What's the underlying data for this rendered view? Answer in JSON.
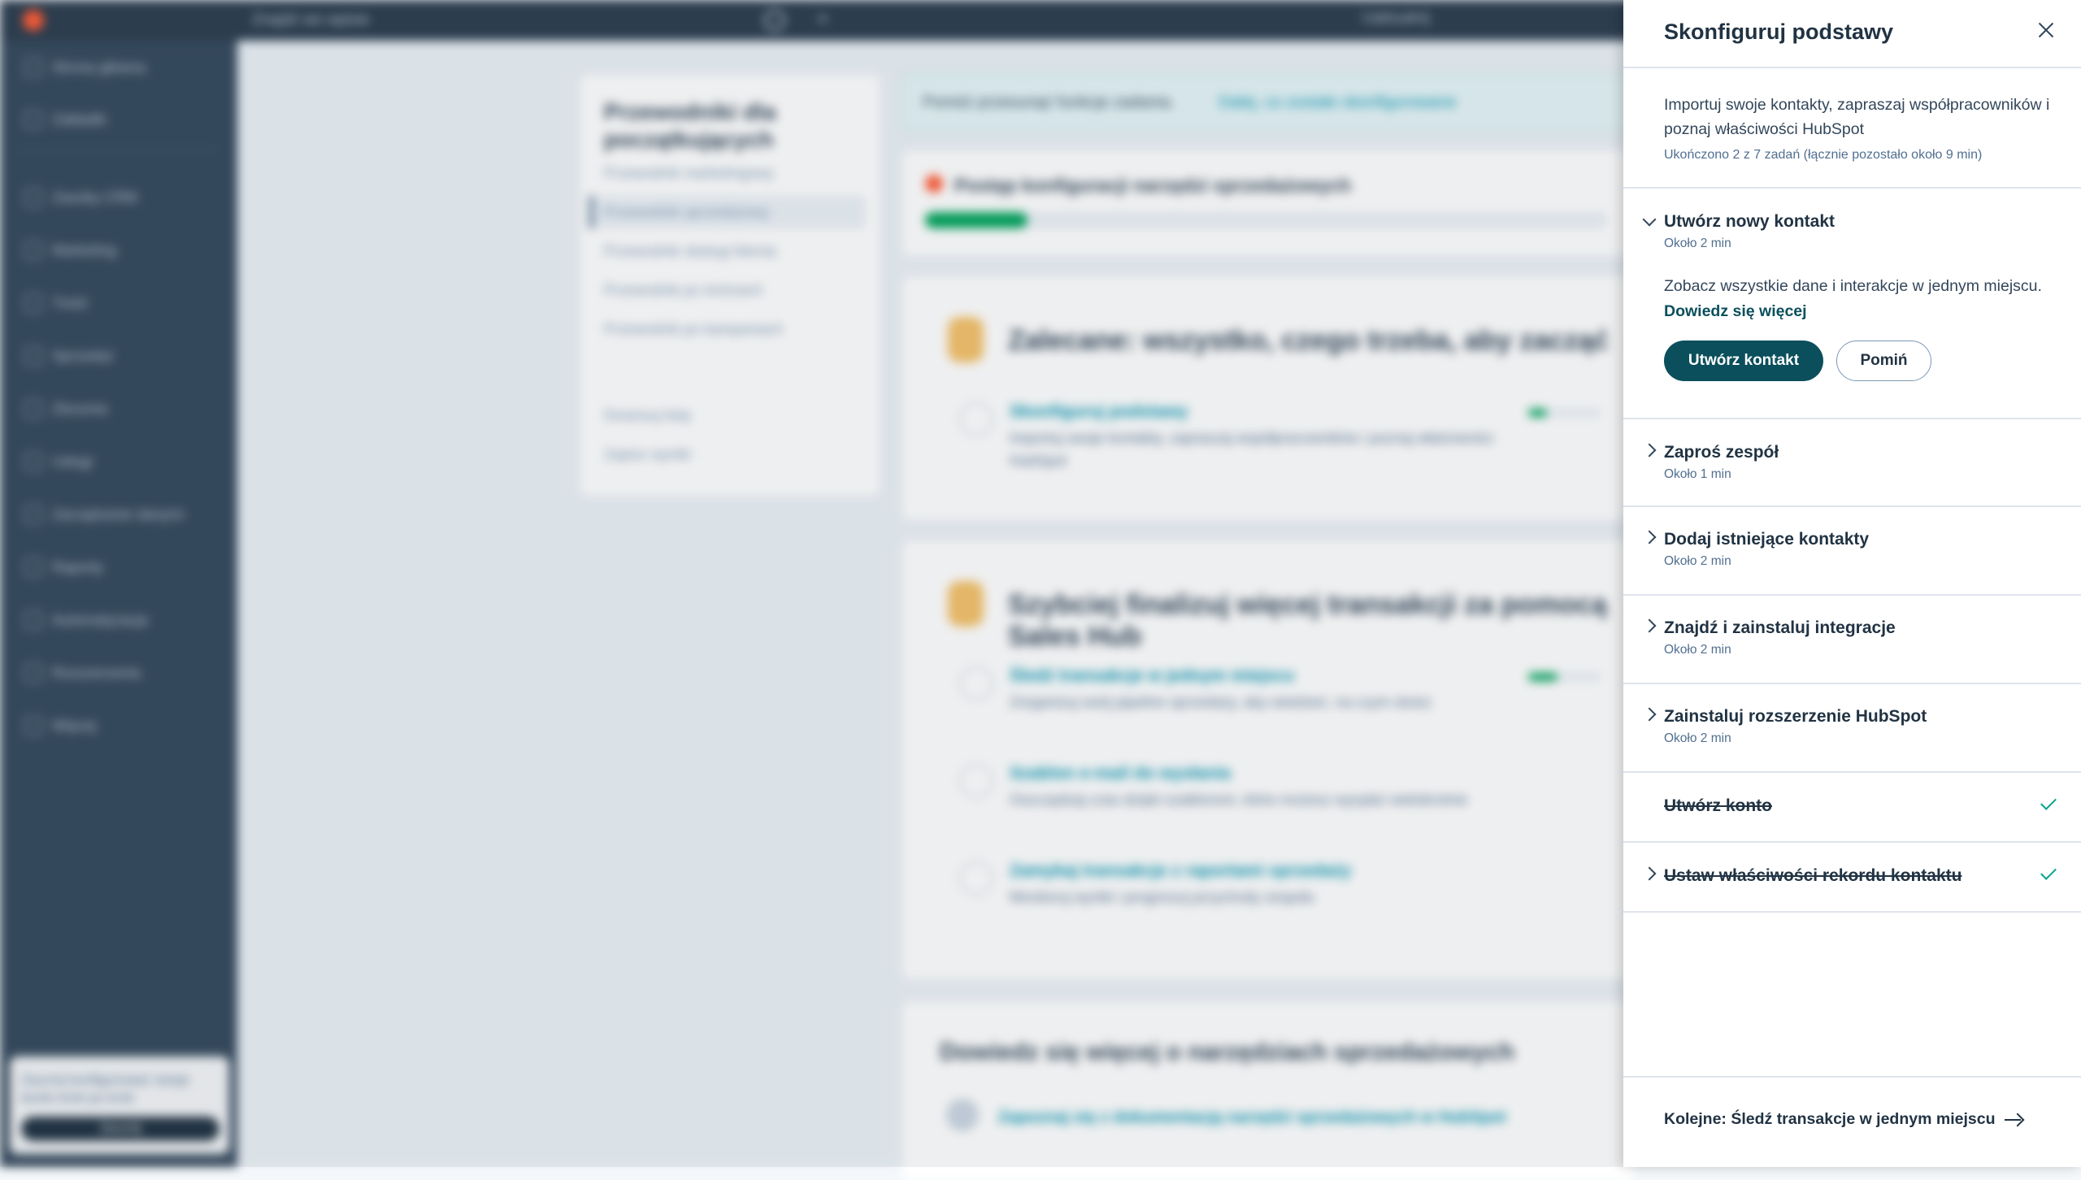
{
  "background": {
    "search_placeholder": "Znajdź we wpisie",
    "upgrade_label": "Uaktualnij",
    "sidebar_items": [
      "Strona główna",
      "Zakładki",
      "Zasoby CRM",
      "Marketing",
      "Treść",
      "Sprzedaż",
      "Zlecenia",
      "Usługi",
      "Zarządzanie danymi",
      "Raporty",
      "Automatyzacja",
      "Rozszerzenia",
      "Więcej"
    ],
    "sidebar_card_text": "Zacznij konfigurować swoje konto krok po krok",
    "sidebar_card_button": "Zacznij",
    "guide_title": "Przewodniki dla początkujących",
    "guide_items": [
      "Przewodnik marketingowy",
      "Przewodnik sprzedażowy",
      "Przewodnik obsługi klienta",
      "Przewodnik po treściach",
      "Przewodnik po kampaniach"
    ],
    "guide_actions": [
      "Dostosuj listę",
      "Zapisz wyniki"
    ],
    "banner_text": "Pomóż przesunąć funkcje zadania.",
    "banner_link": "Dalej, co zostało skonfigurowane",
    "progress_title": "Postęp konfiguracji narzędzi sprzedażowych",
    "progress_fraction": 0.15,
    "section1_title": "Zalecane: wszystko, czego trzeba, aby zacząć",
    "section1_rows": [
      {
        "title": "Skonfiguruj podstawy",
        "desc": "Importuj swoje kontakty, zapraszaj współpracowników i poznaj właściwości HubSpot",
        "progress": 0.25
      }
    ],
    "section2_title": "Szybciej finalizuj więcej transakcji za pomocą Sales Hub",
    "section2_rows": [
      {
        "title": "Śledź transakcje w jednym miejscu",
        "desc": "Zorganizuj swój pipeline sprzedaży, aby wiedzieć, na czym stoisz",
        "progress": 0.4
      },
      {
        "title": "Szablon e-mail do wysłania",
        "desc": "Oszczędzaj czas dzięki szablonom, które możesz wysyłać wielokrotnie",
        "progress": 0
      },
      {
        "title": "Zamykaj transakcje z raportami sprzedaży",
        "desc": "Monitoruj wyniki i prognozuj przychody zespołu",
        "progress": 0
      }
    ],
    "learn_title": "Dowiedz się więcej o narzędziach sprzedażowych",
    "learn_link": "Zapoznaj się z dokumentacją narzędzi sprzedażowych w HubSpot"
  },
  "panel": {
    "title": "Skonfiguruj podstawy",
    "intro": "Importuj swoje kontakty, zapraszaj współpracowników i poznaj właściwości HubSpot",
    "progress_note": "Ukończono 2 z 7 zadań (łącznie pozostało około 9 min)",
    "tasks": [
      {
        "title": "Utwórz nowy kontakt",
        "time": "Około 2 min"
      },
      {
        "title": "Zaproś zespół",
        "time": "Około 1 min"
      },
      {
        "title": "Dodaj istniejące kontakty",
        "time": "Około 2 min"
      },
      {
        "title": "Znajdź i zainstaluj integracje",
        "time": "Około 2 min"
      },
      {
        "title": "Zainstaluj rozszerzenie HubSpot",
        "time": "Około 2 min"
      },
      {
        "title": "Utwórz konto",
        "time": ""
      },
      {
        "title": "Ustaw właściwości rekordu kontaktu",
        "time": ""
      }
    ],
    "expanded": {
      "description": "Zobacz wszystkie dane i interakcje w jednym miejscu.",
      "learn_more": "Dowiedz się więcej",
      "primary_button": "Utwórz kontakt",
      "secondary_button": "Pomiń"
    },
    "next_link": "Kolejne: Śledź transakcje w jednym miejscu"
  }
}
